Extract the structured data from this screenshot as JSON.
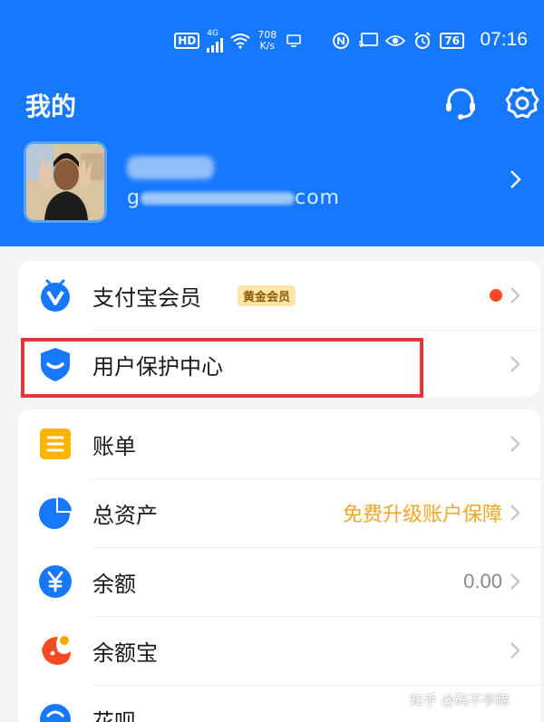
{
  "status_bar": {
    "hd": "HD",
    "network": "4G",
    "speed_value": "708",
    "speed_unit": "K/s",
    "battery": "76",
    "time": "07:16"
  },
  "header": {
    "title": "我的",
    "profile_account_prefix": "g",
    "profile_account_suffix": "com"
  },
  "membership_card": {
    "items": [
      {
        "label": "支付宝会员",
        "badge": "黄金会员",
        "icon": "alipay-member-icon"
      },
      {
        "label": "用户保护中心",
        "icon": "shield-icon"
      }
    ]
  },
  "main_list": {
    "items": [
      {
        "label": "账单",
        "icon": "bill-icon",
        "value": ""
      },
      {
        "label": "总资产",
        "icon": "pie-chart-icon",
        "value": "免费升级账户保障"
      },
      {
        "label": "余额",
        "icon": "yuan-icon",
        "value": "0.00"
      },
      {
        "label": "余额宝",
        "icon": "yuebao-icon",
        "value": ""
      },
      {
        "label": "花呗",
        "icon": "huabei-icon",
        "value": ""
      }
    ]
  },
  "watermark": "知乎 @码不亭蹄",
  "colors": {
    "brand_blue": "#1677ff",
    "highlight_red": "#e8333a",
    "accent_orange": "#f5a623",
    "notification_red": "#fb4b26"
  }
}
